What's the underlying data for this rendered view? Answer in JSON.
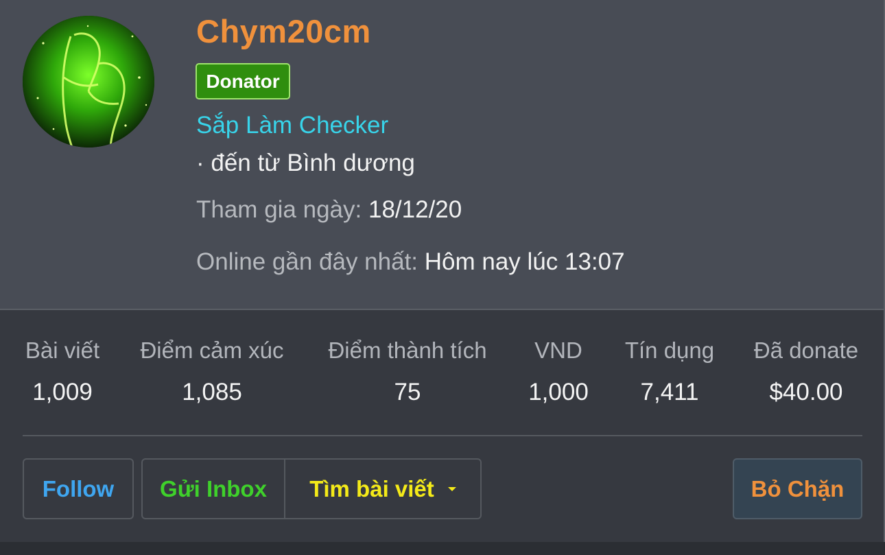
{
  "profile": {
    "username": "Chym20cm",
    "badge": "Donator",
    "user_title": "Sắp Làm Checker",
    "location": "· đến từ Bình dương",
    "joined_label": "Tham gia ngày:",
    "joined_value": "18/12/20",
    "last_seen_label": "Online gần đây nhất:",
    "last_seen_value": "Hôm nay lúc 13:07"
  },
  "stats": [
    {
      "label": "Bài viết",
      "value": "1,009"
    },
    {
      "label": "Điểm cảm xúc",
      "value": "1,085"
    },
    {
      "label": "Điểm thành tích",
      "value": "75"
    },
    {
      "label": "VND",
      "value": "1,000"
    },
    {
      "label": "Tín dụng",
      "value": "7,411"
    },
    {
      "label": "Đã donate",
      "value": "$40.00"
    }
  ],
  "actions": {
    "follow": "Follow",
    "inbox": "Gửi Inbox",
    "find_posts": "Tìm bài viết",
    "unblock": "Bỏ Chặn"
  },
  "colors": {
    "username": "#f0913c",
    "badge_bg": "#2f8e0e",
    "user_title": "#38d4ea",
    "follow": "#3fa6f0",
    "inbox": "#3fd12b",
    "find_posts": "#f4ea19",
    "unblock": "#f0913c"
  },
  "icons": {
    "avatar": "green-glow-couple-avatar",
    "dropdown": "caret-down-icon"
  }
}
